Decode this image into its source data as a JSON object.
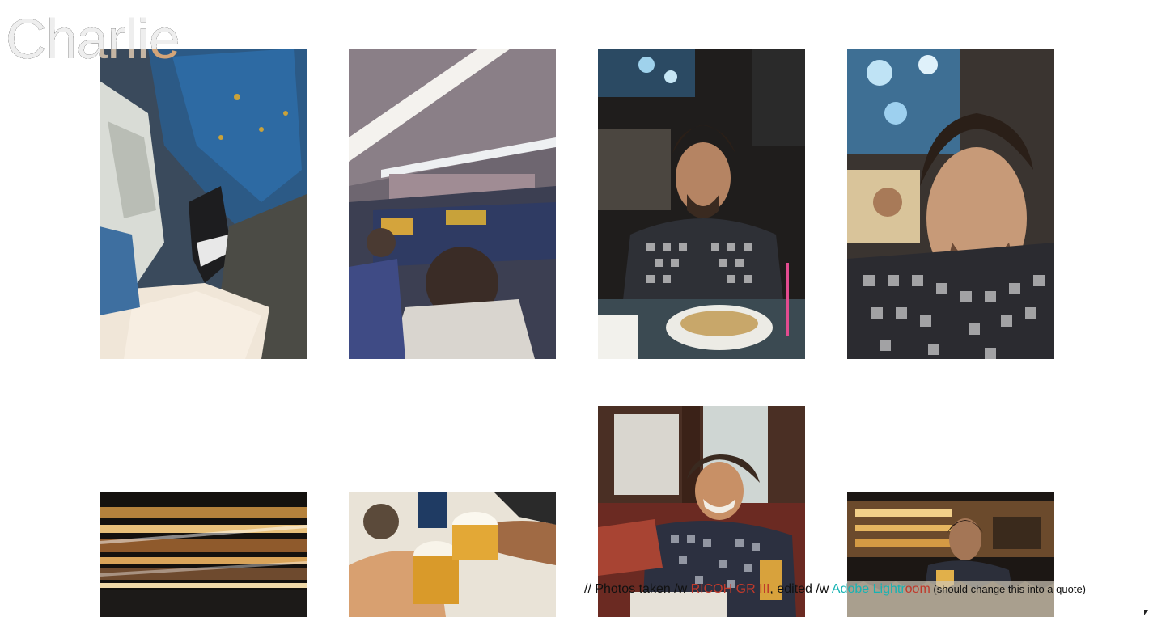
{
  "title": "Charlie",
  "photos": [
    {
      "subject": "sneakers on train seat"
    },
    {
      "subject": "train carriage interior"
    },
    {
      "subject": "man in checked shirt at restaurant table"
    },
    {
      "subject": "man in checked shirt close-up"
    },
    {
      "subject": "blurred bar shelves"
    },
    {
      "subject": "beer glasses toast"
    },
    {
      "subject": "man laughing in booth"
    },
    {
      "subject": "man at bar with drink"
    }
  ],
  "credits": {
    "prefix": "// Photos taken /w ",
    "camera": "RICOH GR III",
    "middle": ", edited /w ",
    "app_part1": "Adobe Lightr",
    "app_part2": "oom",
    "note": " (should change this into a quote)"
  },
  "colors": {
    "camera": "#c0392b",
    "app": "#17b3b3"
  }
}
